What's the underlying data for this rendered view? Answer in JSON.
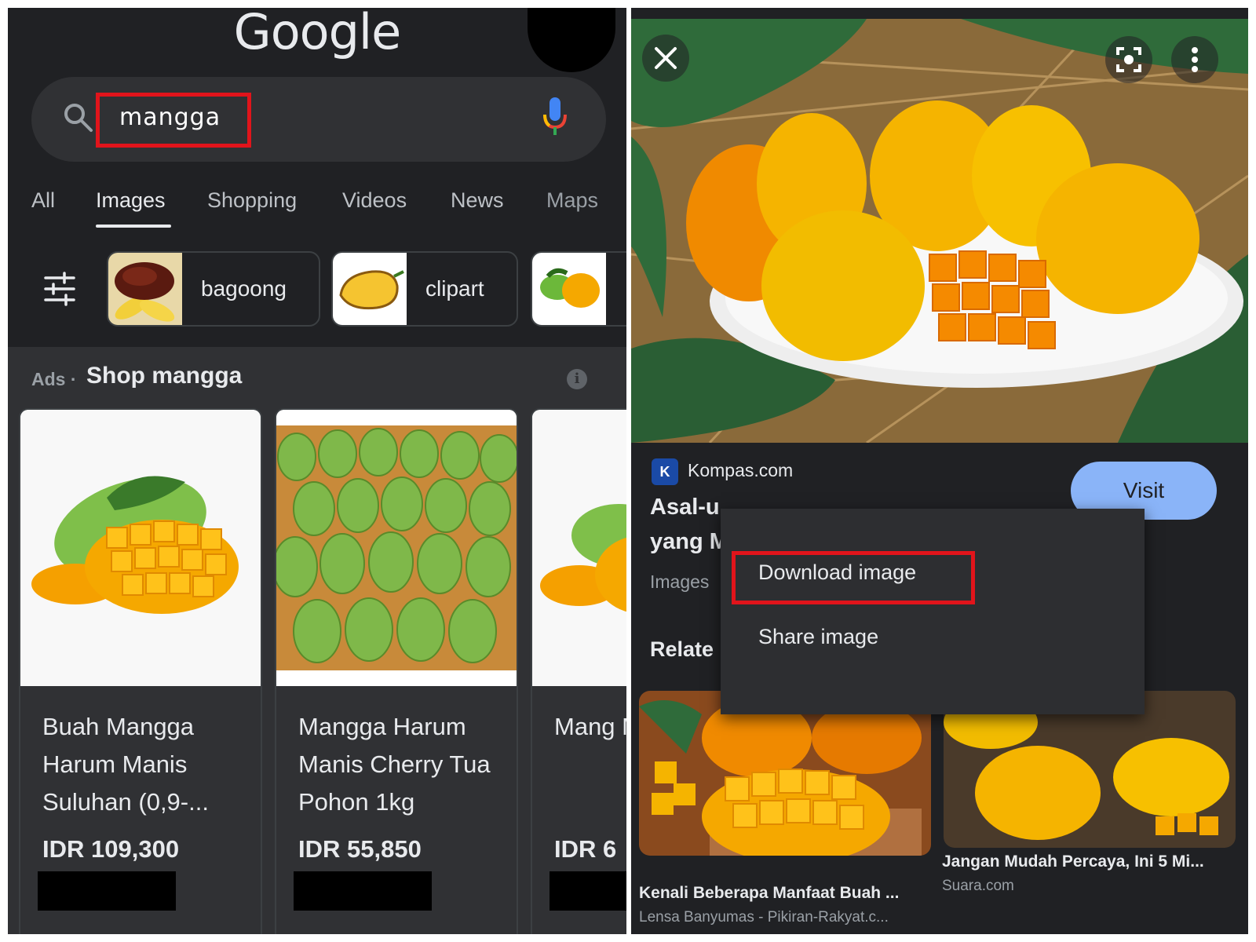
{
  "left": {
    "logo": "Google",
    "search": {
      "query": "mangga"
    },
    "tabs": [
      {
        "label": "All",
        "active": false
      },
      {
        "label": "Images",
        "active": true
      },
      {
        "label": "Shopping",
        "active": false
      },
      {
        "label": "Videos",
        "active": false
      },
      {
        "label": "News",
        "active": false
      },
      {
        "label": "Maps",
        "active": false
      }
    ],
    "chips": [
      {
        "label": "bagoong"
      },
      {
        "label": "clipart"
      },
      {
        "label": ""
      }
    ],
    "ads_label": "Ads ·",
    "shop_title": "Shop mangga",
    "products": [
      {
        "title": "Buah Mangga Harum Manis Suluhan (0,9-...",
        "price": "IDR 109,300"
      },
      {
        "title": "Mangga Harum Manis Cherry Tua Pohon 1kg",
        "price": "IDR 55,850"
      },
      {
        "title": "Mang Manis",
        "price": "IDR 6"
      }
    ]
  },
  "right": {
    "source": {
      "name": "Kompas.com",
      "favicon_letter": "K"
    },
    "visit_label": "Visit",
    "headline_lines": [
      "Asal-u",
      "yang M"
    ],
    "meta": "Images",
    "related_label": "Relate",
    "menu": {
      "download": "Download image",
      "share": "Share image"
    },
    "related": [
      {
        "title": "Kenali Beberapa Manfaat Buah ...",
        "source": "Lensa Banyumas - Pikiran-Rakyat.c..."
      },
      {
        "title": "Jangan Mudah Percaya, Ini 5 Mi...",
        "source": "Suara.com"
      }
    ]
  },
  "colors": {
    "bg_dark": "#202124",
    "surface": "#303134",
    "highlight_red": "#e1141b",
    "visit_blue": "#8ab4f8",
    "mango_yellow": "#f5b400",
    "mango_orange": "#f08a00"
  }
}
